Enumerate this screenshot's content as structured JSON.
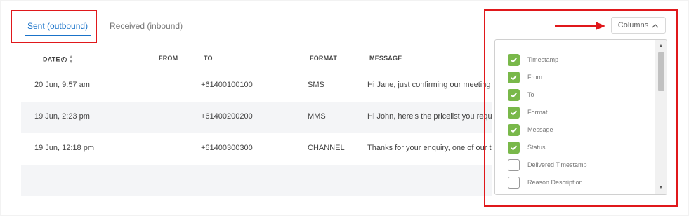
{
  "tabs": [
    {
      "label": "Sent (outbound)",
      "active": true
    },
    {
      "label": "Received (inbound)",
      "active": false
    }
  ],
  "columns_button": {
    "label": "Columns",
    "icon": "chevron-up-icon"
  },
  "table": {
    "headers": [
      "DATE",
      "FROM",
      "TO",
      "FORMAT",
      "MESSAGE"
    ],
    "rows": [
      {
        "date": "20 Jun, 9:57 am",
        "from": "",
        "to": "+61400100100",
        "format": "SMS",
        "message": "Hi Jane, just confirming our meeting"
      },
      {
        "date": "19 Jun, 2:23 pm",
        "from": "",
        "to": "+61400200200",
        "format": "MMS",
        "message": "Hi John, here's the pricelist you reque"
      },
      {
        "date": "19 Jun, 12:18 pm",
        "from": "",
        "to": "+61400300300",
        "format": "CHANNEL",
        "message": "Thanks for your enquiry, one of our te"
      }
    ]
  },
  "columns_panel": {
    "options": [
      {
        "label": "Timestamp",
        "checked": true
      },
      {
        "label": "From",
        "checked": true
      },
      {
        "label": "To",
        "checked": true
      },
      {
        "label": "Format",
        "checked": true
      },
      {
        "label": "Message",
        "checked": true
      },
      {
        "label": "Status",
        "checked": true
      },
      {
        "label": "Delivered Timestamp",
        "checked": false
      },
      {
        "label": "Reason Description",
        "checked": false
      }
    ]
  },
  "colors": {
    "accent": "#1a73c9",
    "checkbox": "#79b84a",
    "highlight": "#e0181b"
  }
}
